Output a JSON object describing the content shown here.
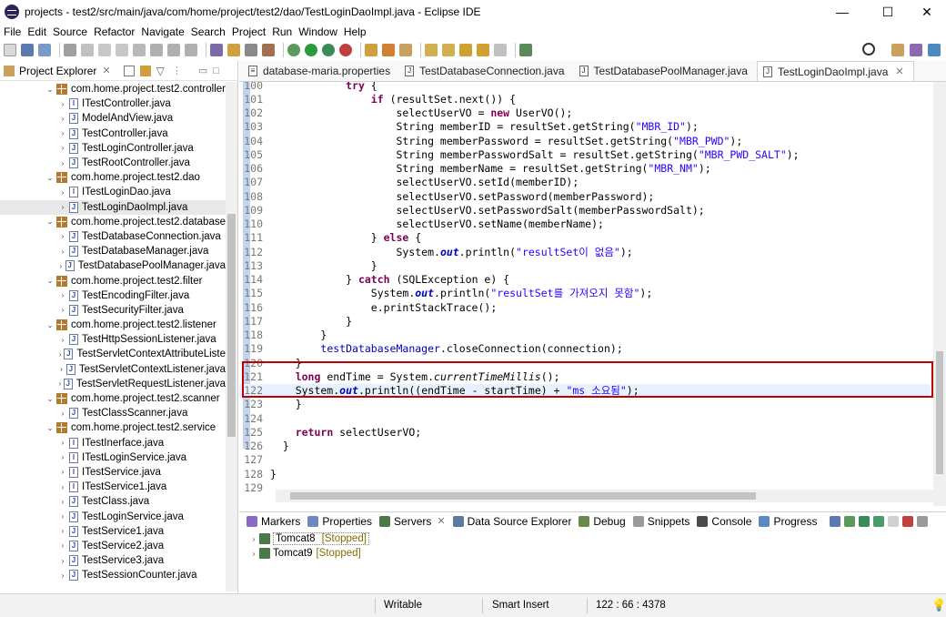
{
  "window": {
    "title": "projects - test2/src/main/java/com/home/project/test2/dao/TestLoginDaoImpl.java - Eclipse IDE",
    "minimize": "—",
    "maximize": "☐",
    "close": "✕"
  },
  "menu": [
    "File",
    "Edit",
    "Source",
    "Refactor",
    "Navigate",
    "Search",
    "Project",
    "Run",
    "Window",
    "Help"
  ],
  "explorer": {
    "title": "Project Explorer",
    "close": "✕",
    "items": [
      {
        "kind": "pkg",
        "label": "com.home.project.test2.controller"
      },
      {
        "kind": "iface",
        "label": "ITestController.java"
      },
      {
        "kind": "file",
        "label": "ModelAndView.java"
      },
      {
        "kind": "file",
        "label": "TestController.java"
      },
      {
        "kind": "file",
        "label": "TestLoginController.java"
      },
      {
        "kind": "file",
        "label": "TestRootController.java"
      },
      {
        "kind": "pkg",
        "label": "com.home.project.test2.dao"
      },
      {
        "kind": "iface",
        "label": "ITestLoginDao.java"
      },
      {
        "kind": "file",
        "label": "TestLoginDaoImpl.java"
      },
      {
        "kind": "pkg",
        "label": "com.home.project.test2.database"
      },
      {
        "kind": "file",
        "label": "TestDatabaseConnection.java"
      },
      {
        "kind": "file",
        "label": "TestDatabaseManager.java"
      },
      {
        "kind": "file",
        "label": "TestDatabasePoolManager.java"
      },
      {
        "kind": "pkg",
        "label": "com.home.project.test2.filter"
      },
      {
        "kind": "file",
        "label": "TestEncodingFilter.java"
      },
      {
        "kind": "file",
        "label": "TestSecurityFilter.java"
      },
      {
        "kind": "pkg",
        "label": "com.home.project.test2.listener"
      },
      {
        "kind": "file",
        "label": "TestHttpSessionListener.java"
      },
      {
        "kind": "file",
        "label": "TestServletContextAttributeListe"
      },
      {
        "kind": "file",
        "label": "TestServletContextListener.java"
      },
      {
        "kind": "file",
        "label": "TestServletRequestListener.java"
      },
      {
        "kind": "pkg",
        "label": "com.home.project.test2.scanner"
      },
      {
        "kind": "file",
        "label": "TestClassScanner.java"
      },
      {
        "kind": "pkg",
        "label": "com.home.project.test2.service"
      },
      {
        "kind": "iface",
        "label": "ITestInerface.java"
      },
      {
        "kind": "iface",
        "label": "ITestLoginService.java"
      },
      {
        "kind": "iface",
        "label": "ITestService.java"
      },
      {
        "kind": "iface",
        "label": "ITestService1.java"
      },
      {
        "kind": "file",
        "label": "TestClass.java"
      },
      {
        "kind": "file",
        "label": "TestLoginService.java"
      },
      {
        "kind": "file",
        "label": "TestService1.java"
      },
      {
        "kind": "file",
        "label": "TestService2.java"
      },
      {
        "kind": "file",
        "label": "TestService3.java"
      },
      {
        "kind": "file",
        "label": "TestSessionCounter.java"
      }
    ]
  },
  "editor_tabs": [
    {
      "label": "database-maria.properties",
      "active": false
    },
    {
      "label": "TestDatabaseConnection.java",
      "active": false
    },
    {
      "label": "TestDatabasePoolManager.java",
      "active": false
    },
    {
      "label": "TestLoginDaoImpl.java",
      "active": true
    }
  ],
  "editor": {
    "lines": [
      {
        "n": "100",
        "tokens": [
          [
            "t",
            "            "
          ],
          [
            "kw",
            "try"
          ],
          [
            "t",
            " {"
          ]
        ]
      },
      {
        "n": "101",
        "tokens": [
          [
            "t",
            "                "
          ],
          [
            "kw",
            "if"
          ],
          [
            "t",
            " (resultSet.next()) {"
          ]
        ]
      },
      {
        "n": "102",
        "tokens": [
          [
            "t",
            "                    selectUserVO = "
          ],
          [
            "kw",
            "new"
          ],
          [
            "t",
            " UserVO();"
          ]
        ]
      },
      {
        "n": "103",
        "tokens": [
          [
            "t",
            "                    String memberID = resultSet.getString("
          ],
          [
            "str",
            "\"MBR_ID\""
          ],
          [
            "t",
            ");"
          ]
        ]
      },
      {
        "n": "104",
        "tokens": [
          [
            "t",
            "                    String memberPassword = resultSet.getString("
          ],
          [
            "str",
            "\"MBR_PWD\""
          ],
          [
            "t",
            ");"
          ]
        ]
      },
      {
        "n": "105",
        "tokens": [
          [
            "t",
            "                    String memberPasswordSalt = resultSet.getString("
          ],
          [
            "str",
            "\"MBR_PWD_SALT\""
          ],
          [
            "t",
            ");"
          ]
        ]
      },
      {
        "n": "106",
        "tokens": [
          [
            "t",
            "                    String memberName = resultSet.getString("
          ],
          [
            "str",
            "\"MBR_NM\""
          ],
          [
            "t",
            ");"
          ]
        ]
      },
      {
        "n": "107",
        "tokens": [
          [
            "t",
            "                    selectUserVO.setId(memberID);"
          ]
        ]
      },
      {
        "n": "108",
        "tokens": [
          [
            "t",
            "                    selectUserVO.setPassword(memberPassword);"
          ]
        ]
      },
      {
        "n": "109",
        "tokens": [
          [
            "t",
            "                    selectUserVO.setPasswordSalt(memberPasswordSalt);"
          ]
        ]
      },
      {
        "n": "110",
        "tokens": [
          [
            "t",
            "                    selectUserVO.setName(memberName);"
          ]
        ]
      },
      {
        "n": "111",
        "tokens": [
          [
            "t",
            "                } "
          ],
          [
            "kw",
            "else"
          ],
          [
            "t",
            " {"
          ]
        ]
      },
      {
        "n": "112",
        "tokens": [
          [
            "t",
            "                    System."
          ],
          [
            "fldi",
            "out"
          ],
          [
            "t",
            ".println("
          ],
          [
            "str",
            "\"resultSet이 없음\""
          ],
          [
            "t",
            ");"
          ]
        ]
      },
      {
        "n": "113",
        "tokens": [
          [
            "t",
            "                }"
          ]
        ]
      },
      {
        "n": "114",
        "tokens": [
          [
            "t",
            "            } "
          ],
          [
            "kw",
            "catch"
          ],
          [
            "t",
            " (SQLException e) {"
          ]
        ]
      },
      {
        "n": "115",
        "tokens": [
          [
            "t",
            "                System."
          ],
          [
            "fldi",
            "out"
          ],
          [
            "t",
            ".println("
          ],
          [
            "str",
            "\"resultSet를 가져오지 못함\""
          ],
          [
            "t",
            ");"
          ]
        ]
      },
      {
        "n": "116",
        "tokens": [
          [
            "t",
            "                e.printStackTrace();"
          ]
        ]
      },
      {
        "n": "117",
        "tokens": [
          [
            "t",
            "            }"
          ]
        ]
      },
      {
        "n": "118",
        "tokens": [
          [
            "t",
            "        }"
          ]
        ]
      },
      {
        "n": "119",
        "tokens": [
          [
            "t",
            "        "
          ],
          [
            "fld",
            "testDatabaseManager"
          ],
          [
            "t",
            ".closeConnection(connection);"
          ]
        ]
      },
      {
        "n": "120",
        "tokens": [
          [
            "t",
            "    }"
          ]
        ]
      },
      {
        "n": "121",
        "tokens": [
          [
            "t",
            "    "
          ],
          [
            "kw",
            "long"
          ],
          [
            "t",
            " endTime = System."
          ],
          [
            "mi",
            "currentTimeMillis"
          ],
          [
            "t",
            "();"
          ]
        ]
      },
      {
        "n": "122",
        "tokens": [
          [
            "t",
            "    System."
          ],
          [
            "fldi",
            "out"
          ],
          [
            "t",
            ".println((endTime - startTime) + "
          ],
          [
            "str",
            "\"ms 소요됨\""
          ],
          [
            "t",
            ");"
          ]
        ]
      },
      {
        "n": "123",
        "tokens": [
          [
            "t",
            "    }"
          ]
        ]
      },
      {
        "n": "124",
        "tokens": [
          [
            "t",
            ""
          ]
        ]
      },
      {
        "n": "125",
        "tokens": [
          [
            "t",
            "    "
          ],
          [
            "kw",
            "return"
          ],
          [
            "t",
            " selectUserVO;"
          ]
        ]
      },
      {
        "n": "126",
        "tokens": [
          [
            "t",
            "  }"
          ]
        ]
      },
      {
        "n": "127",
        "tokens": [
          [
            "t",
            ""
          ]
        ]
      },
      {
        "n": "128",
        "tokens": [
          [
            "t",
            "}"
          ]
        ]
      },
      {
        "n": "129",
        "tokens": [
          [
            "t",
            ""
          ]
        ]
      }
    ],
    "current_line": "122"
  },
  "bottom_tabs": [
    {
      "label": "Markers",
      "color": "#8a6ac0"
    },
    {
      "label": "Properties",
      "color": "#6a8ac0"
    },
    {
      "label": "Servers",
      "color": "#4a7a4a",
      "active": true
    },
    {
      "label": "Data Source Explorer",
      "color": "#5a7aa0"
    },
    {
      "label": "Debug",
      "color": "#6a8a4a"
    },
    {
      "label": "Snippets",
      "color": "#9a9a9a"
    },
    {
      "label": "Console",
      "color": "#4a4a4a"
    },
    {
      "label": "Progress",
      "color": "#5a8ac0"
    }
  ],
  "servers": [
    {
      "name": "Tomcat8",
      "status": "[Stopped]",
      "selected": true
    },
    {
      "name": "Tomcat9",
      "status": "[Stopped]",
      "selected": false
    }
  ],
  "statusbar": {
    "writable": "Writable",
    "insert_mode": "Smart Insert",
    "position": "122 : 66 : 4378"
  }
}
